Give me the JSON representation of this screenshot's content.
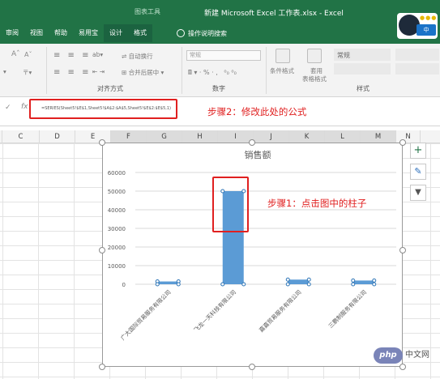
{
  "window": {
    "title": "新建 Microsoft Excel 工作表.xlsx - Excel",
    "contextual_group": "图表工具"
  },
  "ribbon_tabs": [
    {
      "label": "审阅",
      "active": false
    },
    {
      "label": "视图",
      "active": false
    },
    {
      "label": "帮助",
      "active": false
    },
    {
      "label": "易用宝",
      "active": false
    },
    {
      "label": "设计",
      "active": true
    },
    {
      "label": "格式",
      "active": false
    }
  ],
  "search_hint": "操作说明搜索",
  "user_badge": "中",
  "ribbon": {
    "font_group": {
      "grow": "A",
      "shrink": "A"
    },
    "alignment_group": {
      "label": "对齐方式",
      "wrap_text": "自动换行",
      "merge_center": "合并后居中"
    },
    "number_group": {
      "label": "数字",
      "format_value": "常规",
      "percent": "%"
    },
    "styles_group": {
      "label": "样式",
      "conditional_format": "条件格式",
      "table_format_line1": "套用",
      "table_format_line2": "表格格式",
      "cell_style_value": "常规"
    }
  },
  "formula_bar": {
    "fx": "fx",
    "formula": "=SERIES(Sheet5!$E$1,Sheet5!$A$2:$A$5,Sheet5!$E$2:$E$5,1)"
  },
  "annotations": {
    "step2": "步骤2：修改此处的公式",
    "step1": "步骤1：点击图中的柱子"
  },
  "columns": [
    "C",
    "D",
    "E",
    "F",
    "G",
    "H",
    "I",
    "J",
    "K",
    "L",
    "M",
    "N"
  ],
  "selected_columns": [
    "F",
    "G",
    "H",
    "I",
    "J",
    "K",
    "L",
    "M"
  ],
  "side_buttons": [
    {
      "name": "chart-elements-button",
      "glyph": "+"
    },
    {
      "name": "chart-styles-button",
      "glyph": "✎"
    },
    {
      "name": "chart-filters-button",
      "glyph": "▼"
    }
  ],
  "chart_data": {
    "type": "bar",
    "title": "销售额",
    "categories": [
      "广大国际贸易服务有限公司",
      "飞龙一天科技有限公司",
      "嘉嘉贸易服务有限公司",
      "三鹏制服务有限公司"
    ],
    "values": [
      1500,
      50000,
      2500,
      2000
    ],
    "ylim": [
      0,
      60000
    ],
    "yticks": [
      0,
      10000,
      20000,
      30000,
      40000,
      50000,
      60000
    ],
    "grid": true,
    "selected_series": true,
    "bar_color": "#5b9bd5"
  },
  "watermark": {
    "logo": "php",
    "text": "中文网"
  }
}
